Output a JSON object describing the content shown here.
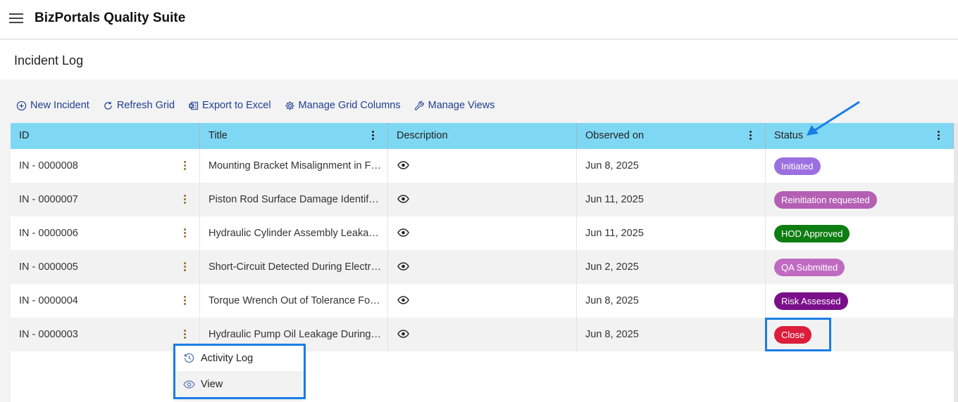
{
  "app": {
    "title": "BizPortals Quality Suite"
  },
  "page": {
    "title": "Incident Log"
  },
  "toolbar": {
    "new_incident": "New Incident",
    "refresh_grid": "Refresh Grid",
    "export_excel": "Export to Excel",
    "manage_columns": "Manage Grid Columns",
    "manage_views": "Manage Views"
  },
  "grid": {
    "columns": [
      "ID",
      "Title",
      "Description",
      "Observed on",
      "Status"
    ],
    "rows": [
      {
        "id": "IN - 0000008",
        "title": "Mounting Bracket Misalignment in Fi...",
        "observed": "Jun 8, 2025",
        "status": "Initiated",
        "status_color": "#9b6fe0"
      },
      {
        "id": "IN - 0000007",
        "title": "Piston Rod Surface Damage Identifie...",
        "observed": "Jun 11, 2025",
        "status": "Reinitiation requested",
        "status_color": "#b45fb4"
      },
      {
        "id": "IN - 0000006",
        "title": "Hydraulic Cylinder Assembly Leakage...",
        "observed": "Jun 11, 2025",
        "status": "HOD Approved",
        "status_color": "#0e7d12"
      },
      {
        "id": "IN - 0000005",
        "title": "Short-Circuit Detected During Electric...",
        "observed": "Jun 2, 2025",
        "status": "QA Submitted",
        "status_color": "#c06ac2"
      },
      {
        "id": "IN - 0000004",
        "title": "Torque Wrench Out of Tolerance Fou...",
        "observed": "Jun 8, 2025",
        "status": "Risk Assessed",
        "status_color": "#7a0f8a"
      },
      {
        "id": "IN - 0000003",
        "title": "Hydraulic Pump Oil Leakage During A...",
        "observed": "Jun 8, 2025",
        "status": "Close",
        "status_color": "#dc1e3c"
      }
    ]
  },
  "context_menu": {
    "activity_log": "Activity Log",
    "view": "View"
  },
  "colors": {
    "header_bg": "#7fd8f3",
    "accent": "#1a7de6",
    "toolbar_text": "#1f3f8f"
  }
}
